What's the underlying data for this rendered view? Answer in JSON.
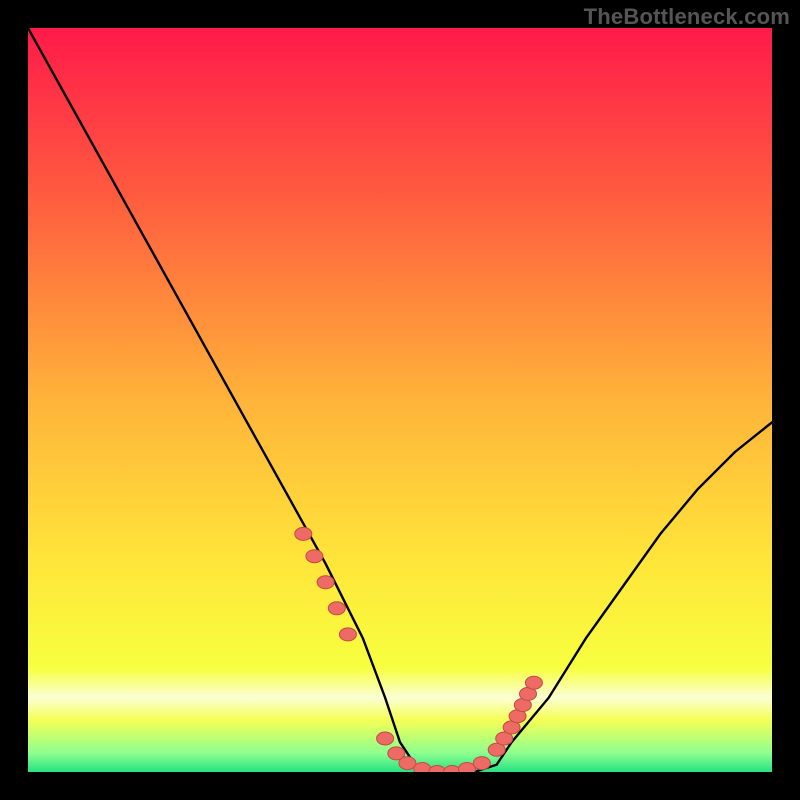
{
  "watermark": "TheBottleneck.com",
  "colors": {
    "frame": "#000000",
    "gradient_top": "#ff1a4a",
    "gradient_mid_upper": "#ff6b3c",
    "gradient_mid": "#ffd23f",
    "gradient_lower": "#f7ff3f",
    "gradient_pale_band": "#fbffd4",
    "gradient_bottom": "#27e183",
    "curve": "#000000",
    "dot_fill": "#ed6b64",
    "dot_stroke": "#c24a46"
  },
  "chart_data": {
    "type": "line",
    "title": "",
    "xlabel": "",
    "ylabel": "",
    "xlim": [
      0,
      100
    ],
    "ylim": [
      0,
      100
    ],
    "grid": false,
    "legend": false,
    "series": [
      {
        "name": "bottleneck-curve",
        "x": [
          0,
          5,
          10,
          15,
          20,
          25,
          30,
          35,
          40,
          45,
          48,
          50,
          52,
          55,
          58,
          60,
          63,
          65,
          70,
          75,
          80,
          85,
          90,
          95,
          100
        ],
        "y": [
          100,
          91,
          82,
          73,
          64,
          55,
          46,
          37,
          28,
          18,
          10,
          4,
          1,
          0,
          0,
          0,
          1,
          4,
          10,
          18,
          25,
          32,
          38,
          43,
          47
        ]
      }
    ],
    "highlight_points": {
      "name": "highlight-dots",
      "x": [
        37,
        38.5,
        40,
        41.5,
        43,
        48,
        49.5,
        51,
        53,
        55,
        57,
        59,
        61,
        63,
        64,
        65,
        65.8,
        66.5,
        67.2,
        68
      ],
      "y": [
        32,
        29,
        25.5,
        22,
        18.5,
        4.5,
        2.5,
        1.2,
        0.4,
        0,
        0,
        0.4,
        1.2,
        3,
        4.5,
        6,
        7.5,
        9,
        10.5,
        12
      ]
    },
    "annotations": []
  }
}
